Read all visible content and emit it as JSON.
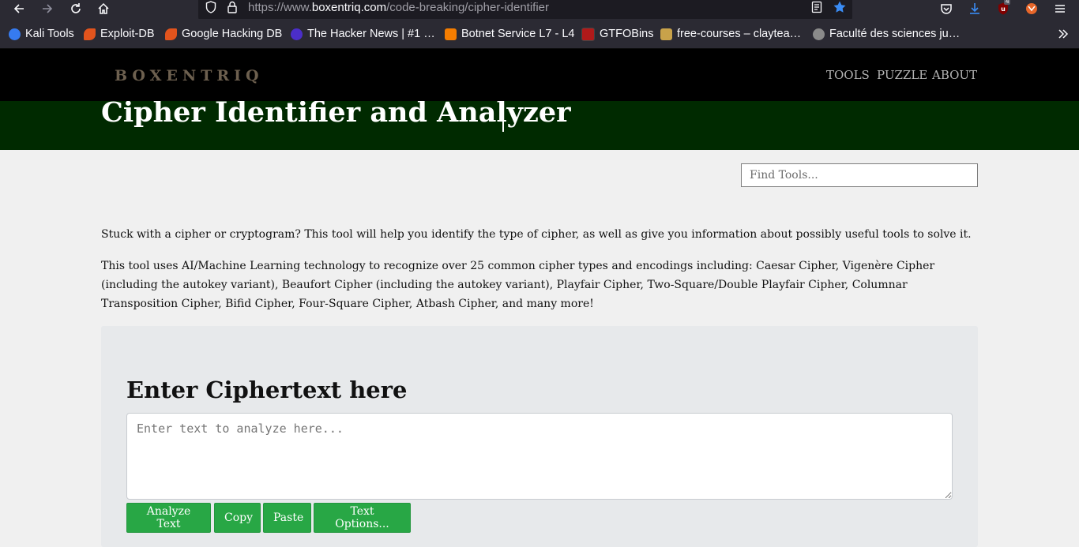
{
  "browser": {
    "url_scheme": "https://www.",
    "url_host": "boxentriq.com",
    "url_path": "/code-breaking/cipher-identifier",
    "bookmarks": [
      {
        "label": "Kali Tools",
        "color": "#367bf0"
      },
      {
        "label": "Exploit-DB",
        "color": "#e2541d"
      },
      {
        "label": "Google Hacking DB",
        "color": "#e2541d"
      },
      {
        "label": "The Hacker News | #1 …",
        "color": "#4b2ec9"
      },
      {
        "label": "Botnet Service L7 - L4",
        "color": "#f57d00"
      },
      {
        "label": "GTFOBins",
        "color": "#b01a1a"
      },
      {
        "label": "free-courses – claytea…",
        "color": "#c8a24a"
      },
      {
        "label": "Faculté des sciences ju…",
        "color": "#8a8a8a"
      }
    ],
    "badge_count": "4"
  },
  "site": {
    "logo": "BOXENTRIQ",
    "nav": [
      "TOOLS",
      "PUZZLE",
      "ABOUT"
    ],
    "hero_title": "Cipher Identifier and Analyzer",
    "search_placeholder": "Find Tools...",
    "intro": "Stuck with a cipher or cryptogram? This tool will help you identify the type of cipher, as well as give you information about possibly useful tools to solve it.",
    "description": "This tool uses AI/Machine Learning technology to recognize over 25 common cipher types and encodings including: Caesar Cipher, Vigenère Cipher (including the autokey variant), Beaufort Cipher (including the autokey variant), Playfair Cipher, Two-Square/Double Playfair Cipher, Columnar Transposition Cipher, Bifid Cipher, Four-Square Cipher, Atbash Cipher, and many more!",
    "panel_heading": "Enter Ciphertext here",
    "input_placeholder": "Enter text to analyze here...",
    "buttons": [
      "Analyze Text",
      "Copy",
      "Paste",
      "Text Options..."
    ]
  },
  "colors": {
    "hero_bg": "#002a00",
    "button_green": "#28a745",
    "logo": "#6d604f"
  }
}
